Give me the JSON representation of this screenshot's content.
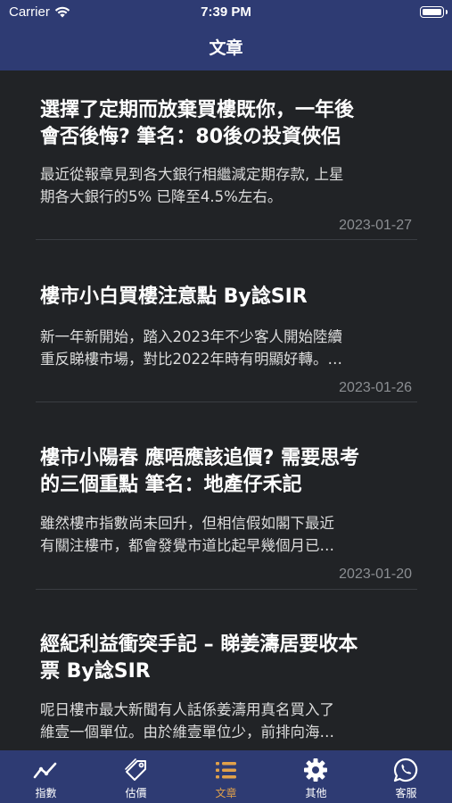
{
  "status_bar": {
    "carrier": "Carrier",
    "time": "7:39 PM"
  },
  "nav": {
    "title": "文章"
  },
  "articles": [
    {
      "title_lines": [
        "選擇了定期而放棄買樓既你，一年後",
        "會否後悔? 筆名：80後の投資俠侶"
      ],
      "summary_lines": [
        "最近從報章見到各大銀行相繼減定期存款, 上星",
        "期各大銀行的5% 已降至4.5%左右。"
      ],
      "date": "2023-01-27"
    },
    {
      "title_lines": [
        "樓市小白買樓注意點 By諗SIR"
      ],
      "summary_lines": [
        "新一年新開始，踏入2023年不少客人開始陸續",
        "重反睇樓市場，對比2022年時有明顯好轉。…"
      ],
      "date": "2023-01-26"
    },
    {
      "title_lines": [
        "樓市小陽春 應唔應該追價? 需要思考",
        "的三個重點 筆名：地產仔禾記"
      ],
      "summary_lines": [
        "雖然樓市指數尚未回升，但相信假如閣下最近",
        "有關注樓市，都會發覺市道比起早幾個月已…"
      ],
      "date": "2023-01-20"
    },
    {
      "title_lines": [
        "經紀利益衝突手記 – 睇姜濤居要收本",
        "票 By諗SIR"
      ],
      "summary_lines": [
        "呢日樓市最大新聞有人話係姜濤用真名買入了",
        "維壹一個單位。由於維壹單位少，前排向海…"
      ],
      "date": ""
    }
  ],
  "tabs": [
    {
      "label": "指數",
      "icon": "chart-line-icon",
      "active": false
    },
    {
      "label": "估價",
      "icon": "price-tag-icon",
      "active": false
    },
    {
      "label": "文章",
      "icon": "list-icon",
      "active": true
    },
    {
      "label": "其他",
      "icon": "gear-icon",
      "active": false
    },
    {
      "label": "客服",
      "icon": "whatsapp-icon",
      "active": false
    }
  ],
  "colors": {
    "nav_background": "#2e3b73",
    "page_background": "#212326",
    "active_tab": "#e1a14a",
    "date_text": "#8b8e92"
  }
}
